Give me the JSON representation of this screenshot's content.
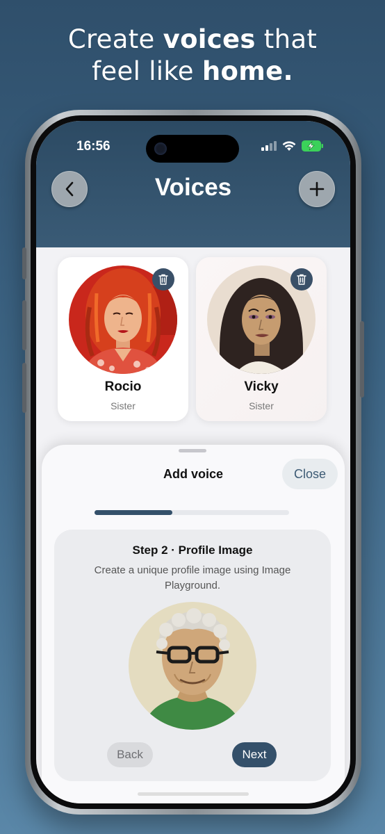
{
  "headline": {
    "pre": "Create ",
    "bold1": "voices",
    "mid": " that",
    "line2_pre": "feel like ",
    "bold2": "home."
  },
  "status_bar": {
    "time": "16:56",
    "icons": [
      "signal-icon",
      "wifi-icon",
      "battery-charging-icon"
    ]
  },
  "nav": {
    "title": "Voices",
    "back_icon": "chevron-left-icon",
    "add_icon": "plus-icon"
  },
  "voices": [
    {
      "name": "Rocio",
      "relation": "Sister",
      "delete_icon": "trash-icon"
    },
    {
      "name": "Vicky",
      "relation": "Sister",
      "delete_icon": "trash-icon"
    }
  ],
  "sheet": {
    "title": "Add voice",
    "close_label": "Close",
    "progress": 0.4,
    "step_title": "Step 2 · Profile Image",
    "step_description": "Create a unique profile image using Image Playground.",
    "back_label": "Back",
    "next_label": "Next"
  },
  "colors": {
    "accent": "#34506a",
    "nav_bg": "#2c4a63",
    "background_top": "#2f4f6b",
    "background_bottom": "#5a87a8"
  }
}
